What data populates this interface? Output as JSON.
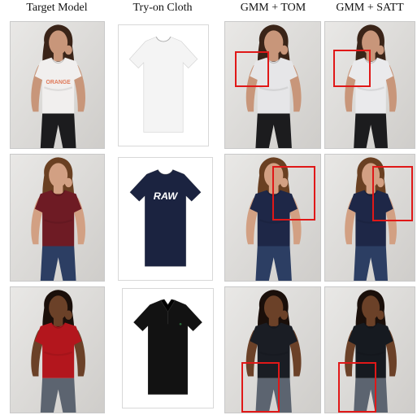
{
  "headers": [
    "Target Model",
    "Try-on Cloth",
    "GMM + TOM",
    "GMM + SATT"
  ],
  "rows": [
    {
      "model": {
        "skin": "#c8967a",
        "hair": "#3a2418",
        "shirt": "#f1efee",
        "shirt_text": "ORANGE",
        "pants": "#1c1c1e"
      },
      "cloth": {
        "color": "#f4f4f4",
        "print": "",
        "collar": "crew"
      },
      "tom": {
        "skin": "#c8967a",
        "hair": "#3a2418",
        "shirt": "#e6e6e8",
        "pants": "#1c1c1e"
      },
      "satt": {
        "skin": "#c8967a",
        "hair": "#3a2418",
        "shirt": "#eaeaec",
        "pants": "#1c1c1e"
      }
    },
    {
      "model": {
        "skin": "#d2a083",
        "hair": "#6a4022",
        "shirt": "#6e1b24",
        "shirt_text": "",
        "pants": "#2c3e63"
      },
      "cloth": {
        "color": "#1b2340",
        "print": "RAW",
        "collar": "crew"
      },
      "tom": {
        "skin": "#d2a083",
        "hair": "#6a4022",
        "shirt": "#1e2747",
        "pants": "#2c3e63"
      },
      "satt": {
        "skin": "#d2a083",
        "hair": "#6a4022",
        "shirt": "#1e2747",
        "pants": "#2c3e63"
      }
    },
    {
      "model": {
        "skin": "#6b4128",
        "hair": "#1a0f0a",
        "shirt": "#b3161d",
        "shirt_text": "",
        "pants": "#5c6470"
      },
      "cloth": {
        "color": "#121212",
        "print": "",
        "collar": "polo"
      },
      "tom": {
        "skin": "#6b4128",
        "hair": "#1a0f0a",
        "shirt": "#1a1d24",
        "pants": "#5c6470"
      },
      "satt": {
        "skin": "#6b4128",
        "hair": "#1a0f0a",
        "shirt": "#161a20",
        "pants": "#5c6470"
      }
    }
  ],
  "highlight_color": "#e01818"
}
